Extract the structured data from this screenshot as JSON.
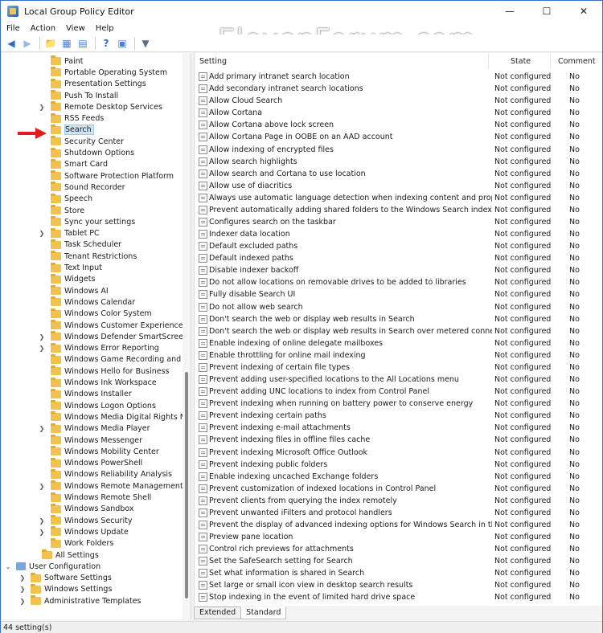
{
  "window": {
    "title": "Local Group Policy Editor",
    "watermark": "ElevenForum.com"
  },
  "menu": [
    "File",
    "Action",
    "View",
    "Help"
  ],
  "tree": {
    "items": [
      {
        "label": "Paint",
        "expandable": false
      },
      {
        "label": "Portable Operating System",
        "expandable": false
      },
      {
        "label": "Presentation Settings",
        "expandable": false
      },
      {
        "label": "Push To Install",
        "expandable": false
      },
      {
        "label": "Remote Desktop Services",
        "expandable": true
      },
      {
        "label": "RSS Feeds",
        "expandable": false
      },
      {
        "label": "Search",
        "expandable": false,
        "selected": true
      },
      {
        "label": "Security Center",
        "expandable": false
      },
      {
        "label": "Shutdown Options",
        "expandable": false
      },
      {
        "label": "Smart Card",
        "expandable": false
      },
      {
        "label": "Software Protection Platform",
        "expandable": false
      },
      {
        "label": "Sound Recorder",
        "expandable": false
      },
      {
        "label": "Speech",
        "expandable": false
      },
      {
        "label": "Store",
        "expandable": false
      },
      {
        "label": "Sync your settings",
        "expandable": false
      },
      {
        "label": "Tablet PC",
        "expandable": true
      },
      {
        "label": "Task Scheduler",
        "expandable": false
      },
      {
        "label": "Tenant Restrictions",
        "expandable": false
      },
      {
        "label": "Text Input",
        "expandable": false
      },
      {
        "label": "Widgets",
        "expandable": false
      },
      {
        "label": "Windows AI",
        "expandable": false
      },
      {
        "label": "Windows Calendar",
        "expandable": false
      },
      {
        "label": "Windows Color System",
        "expandable": false
      },
      {
        "label": "Windows Customer Experience Imp",
        "expandable": false
      },
      {
        "label": "Windows Defender SmartScreen",
        "expandable": true
      },
      {
        "label": "Windows Error Reporting",
        "expandable": true
      },
      {
        "label": "Windows Game Recording and Bro",
        "expandable": false
      },
      {
        "label": "Windows Hello for Business",
        "expandable": false
      },
      {
        "label": "Windows Ink Workspace",
        "expandable": false
      },
      {
        "label": "Windows Installer",
        "expandable": false
      },
      {
        "label": "Windows Logon Options",
        "expandable": false
      },
      {
        "label": "Windows Media Digital Rights Ma",
        "expandable": false
      },
      {
        "label": "Windows Media Player",
        "expandable": true
      },
      {
        "label": "Windows Messenger",
        "expandable": false
      },
      {
        "label": "Windows Mobility Center",
        "expandable": false
      },
      {
        "label": "Windows PowerShell",
        "expandable": false
      },
      {
        "label": "Windows Reliability Analysis",
        "expandable": false
      },
      {
        "label": "Windows Remote Management (W",
        "expandable": true
      },
      {
        "label": "Windows Remote Shell",
        "expandable": false
      },
      {
        "label": "Windows Sandbox",
        "expandable": false
      },
      {
        "label": "Windows Security",
        "expandable": true
      },
      {
        "label": "Windows Update",
        "expandable": true
      },
      {
        "label": "Work Folders",
        "expandable": false
      }
    ],
    "all_settings": "All Settings",
    "user_config": "User Configuration",
    "user_children": [
      "Software Settings",
      "Windows Settings",
      "Administrative Templates"
    ]
  },
  "list": {
    "headers": {
      "setting": "Setting",
      "state": "State",
      "comment": "Comment"
    },
    "rows": [
      {
        "setting": "Add primary intranet search location",
        "state": "Not configured",
        "comment": "No"
      },
      {
        "setting": "Add secondary intranet search locations",
        "state": "Not configured",
        "comment": "No"
      },
      {
        "setting": "Allow Cloud Search",
        "state": "Not configured",
        "comment": "No"
      },
      {
        "setting": "Allow Cortana",
        "state": "Not configured",
        "comment": "No"
      },
      {
        "setting": "Allow Cortana above lock screen",
        "state": "Not configured",
        "comment": "No"
      },
      {
        "setting": "Allow Cortana Page in OOBE on an AAD account",
        "state": "Not configured",
        "comment": "No"
      },
      {
        "setting": "Allow indexing of encrypted files",
        "state": "Not configured",
        "comment": "No"
      },
      {
        "setting": "Allow search highlights",
        "state": "Not configured",
        "comment": "No"
      },
      {
        "setting": "Allow search and Cortana to use location",
        "state": "Not configured",
        "comment": "No"
      },
      {
        "setting": "Allow use of diacritics",
        "state": "Not configured",
        "comment": "No"
      },
      {
        "setting": "Always use automatic language detection when indexing content and properties",
        "state": "Not configured",
        "comment": "No"
      },
      {
        "setting": "Prevent automatically adding shared folders to the Windows Search index",
        "state": "Not configured",
        "comment": "No"
      },
      {
        "setting": "Configures search on the taskbar",
        "state": "Not configured",
        "comment": "No"
      },
      {
        "setting": "Indexer data location",
        "state": "Not configured",
        "comment": "No"
      },
      {
        "setting": "Default excluded paths",
        "state": "Not configured",
        "comment": "No"
      },
      {
        "setting": "Default indexed paths",
        "state": "Not configured",
        "comment": "No"
      },
      {
        "setting": "Disable indexer backoff",
        "state": "Not configured",
        "comment": "No"
      },
      {
        "setting": "Do not allow locations on removable drives to be added to libraries",
        "state": "Not configured",
        "comment": "No"
      },
      {
        "setting": "Fully disable Search UI",
        "state": "Not configured",
        "comment": "No"
      },
      {
        "setting": "Do not allow web search",
        "state": "Not configured",
        "comment": "No"
      },
      {
        "setting": "Don't search the web or display web results in Search",
        "state": "Not configured",
        "comment": "No"
      },
      {
        "setting": "Don't search the web or display web results in Search over metered connections",
        "state": "Not configured",
        "comment": "No"
      },
      {
        "setting": "Enable indexing of online delegate mailboxes",
        "state": "Not configured",
        "comment": "No"
      },
      {
        "setting": "Enable throttling for online mail indexing",
        "state": "Not configured",
        "comment": "No"
      },
      {
        "setting": "Prevent indexing of certain file types",
        "state": "Not configured",
        "comment": "No"
      },
      {
        "setting": "Prevent adding user-specified locations to the All Locations menu",
        "state": "Not configured",
        "comment": "No"
      },
      {
        "setting": "Prevent adding UNC locations to index from Control Panel",
        "state": "Not configured",
        "comment": "No"
      },
      {
        "setting": "Prevent indexing when running on battery power to conserve energy",
        "state": "Not configured",
        "comment": "No"
      },
      {
        "setting": "Prevent indexing certain paths",
        "state": "Not configured",
        "comment": "No"
      },
      {
        "setting": "Prevent indexing e-mail attachments",
        "state": "Not configured",
        "comment": "No"
      },
      {
        "setting": "Prevent indexing files in offline files cache",
        "state": "Not configured",
        "comment": "No"
      },
      {
        "setting": "Prevent indexing Microsoft Office Outlook",
        "state": "Not configured",
        "comment": "No"
      },
      {
        "setting": "Prevent indexing public folders",
        "state": "Not configured",
        "comment": "No"
      },
      {
        "setting": "Enable indexing uncached Exchange folders",
        "state": "Not configured",
        "comment": "No"
      },
      {
        "setting": "Prevent customization of indexed locations in Control Panel",
        "state": "Not configured",
        "comment": "No"
      },
      {
        "setting": "Prevent clients from querying the index remotely",
        "state": "Not configured",
        "comment": "No"
      },
      {
        "setting": "Prevent unwanted iFilters and protocol handlers",
        "state": "Not configured",
        "comment": "No"
      },
      {
        "setting": "Prevent the display of advanced indexing options for Windows Search in the Cont...",
        "state": "Not configured",
        "comment": "No"
      },
      {
        "setting": "Preview pane location",
        "state": "Not configured",
        "comment": "No"
      },
      {
        "setting": "Control rich previews for attachments",
        "state": "Not configured",
        "comment": "No"
      },
      {
        "setting": "Set the SafeSearch setting for Search",
        "state": "Not configured",
        "comment": "No"
      },
      {
        "setting": "Set what information is shared in Search",
        "state": "Not configured",
        "comment": "No"
      },
      {
        "setting": "Set large or small icon view in desktop search results",
        "state": "Not configured",
        "comment": "No"
      },
      {
        "setting": "Stop indexing in the event of limited hard drive space",
        "state": "Not configured",
        "comment": "No"
      }
    ]
  },
  "tabs": [
    "Extended",
    "Standard"
  ],
  "status": "44 setting(s)",
  "colors": {
    "selection": "#cce4f7",
    "arrow": "#e31b1b",
    "folder": "#f1c24d"
  }
}
